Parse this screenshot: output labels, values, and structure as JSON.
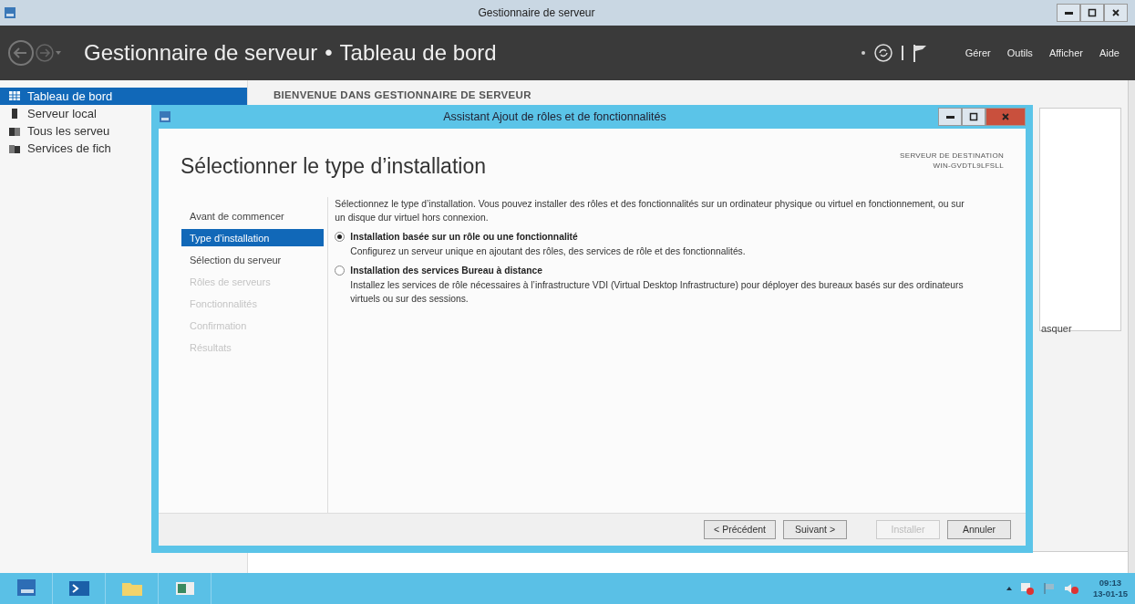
{
  "window": {
    "title": "Gestionnaire de serveur"
  },
  "header": {
    "app": "Gestionnaire de serveur",
    "separator": "•",
    "page": "Tableau de bord",
    "menus": [
      "Gérer",
      "Outils",
      "Afficher",
      "Aide"
    ]
  },
  "sidebar": {
    "items": [
      {
        "label": "Tableau de bord",
        "selected": true,
        "kind": "grid"
      },
      {
        "label": "Serveur local",
        "selected": false,
        "kind": "server"
      },
      {
        "label": "Tous les serveu",
        "selected": false,
        "kind": "servers"
      },
      {
        "label": "Services de fich",
        "selected": false,
        "kind": "files"
      }
    ]
  },
  "content": {
    "welcome": "BIENVENUE DANS GESTIONNAIRE DE SERVEUR",
    "side_link": "asquer"
  },
  "wizard": {
    "title": "Assistant Ajout de rôles et de fonctionnalités",
    "heading": "Sélectionner le type d’installation",
    "destination_label": "SERVEUR DE DESTINATION",
    "destination_server": "WIN-GVDTL9LFSLL",
    "steps": [
      {
        "label": "Avant de commencer",
        "selected": false,
        "disabled": false
      },
      {
        "label": "Type d’installation",
        "selected": true,
        "disabled": false
      },
      {
        "label": "Sélection du serveur",
        "selected": false,
        "disabled": false
      },
      {
        "label": "Rôles de serveurs",
        "selected": false,
        "disabled": true
      },
      {
        "label": "Fonctionnalités",
        "selected": false,
        "disabled": true
      },
      {
        "label": "Confirmation",
        "selected": false,
        "disabled": true
      },
      {
        "label": "Résultats",
        "selected": false,
        "disabled": true
      }
    ],
    "intro": "Sélectionnez le type d’installation. Vous pouvez installer des rôles et des fonctionnalités sur un ordinateur physique ou virtuel en fonctionnement, ou sur un disque dur virtuel hors connexion.",
    "options": [
      {
        "label": "Installation basée sur un rôle ou une fonctionnalité",
        "description": "Configurez un serveur unique en ajoutant des rôles, des services de rôle et des fonctionnalités.",
        "selected": true
      },
      {
        "label": "Installation des services Bureau à distance",
        "description": "Installez les services de rôle nécessaires à l’infrastructure VDI (Virtual Desktop Infrastructure) pour déployer des bureaux basés sur des ordinateurs virtuels ou sur des sessions.",
        "selected": false
      }
    ],
    "buttons": [
      {
        "label": "< Précédent",
        "disabled": false
      },
      {
        "label": "Suivant >",
        "disabled": false
      },
      {
        "label": "Installer",
        "disabled": true
      },
      {
        "label": "Annuler",
        "disabled": false
      }
    ]
  },
  "taskbar": {
    "time": "09:13",
    "date": "13-01-15"
  }
}
